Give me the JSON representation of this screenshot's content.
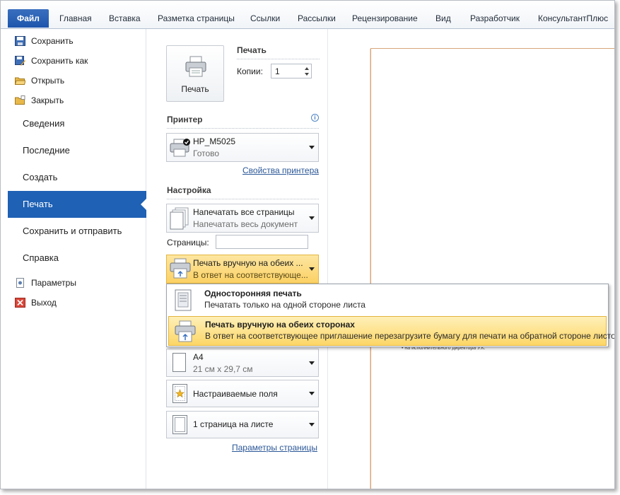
{
  "ribbon": {
    "tabs": [
      "Файл",
      "Главная",
      "Вставка",
      "Разметка страницы",
      "Ссылки",
      "Рассылки",
      "Рецензирование",
      "Вид",
      "Разработчик",
      "КонсультантПлюс"
    ]
  },
  "nav": {
    "save": "Сохранить",
    "save_as": "Сохранить как",
    "open": "Открыть",
    "close": "Закрыть",
    "info": "Сведения",
    "recent": "Последние",
    "new": "Создать",
    "print": "Печать",
    "save_send": "Сохранить и отправить",
    "help": "Справка",
    "options": "Параметры",
    "exit": "Выход"
  },
  "print": {
    "section_title": "Печать",
    "button_label": "Печать",
    "copies_label": "Копии:",
    "copies_value": "1"
  },
  "printer": {
    "section_title": "Принтер",
    "info_symbol": "i",
    "name": "HP_M5025",
    "status": "Готово",
    "properties_link": "Свойства принтера"
  },
  "settings": {
    "section_title": "Настройка",
    "pages_main": "Напечатать все страницы",
    "pages_sub": "Напечатать весь документ",
    "pages_label": "Страницы:",
    "pages_value": "",
    "duplex_main": "Печать вручную на обеих ...",
    "duplex_sub": "В ответ на соответствующе...",
    "paper_main": "А4",
    "paper_sub": "21 см x 29,7 см",
    "margins": "Настраиваемые поля",
    "per_sheet": "1 страница на листе",
    "page_setup_link": "Параметры страницы"
  },
  "duplex_menu": [
    {
      "title": "Односторонняя печать",
      "desc": "Печатать только на одной стороне листа"
    },
    {
      "title": "Печать вручную на обеих сторонах",
      "desc": "В ответ на соответствующее приглашение перезагрузите бумагу для печати на обратной стороне листов"
    }
  ],
  "preview": {
    "page_text": "• на исполнительного директора У.К."
  },
  "colors": {
    "accent": "#1e61b5",
    "highlight": "#fbd164",
    "link": "#2b5797"
  }
}
